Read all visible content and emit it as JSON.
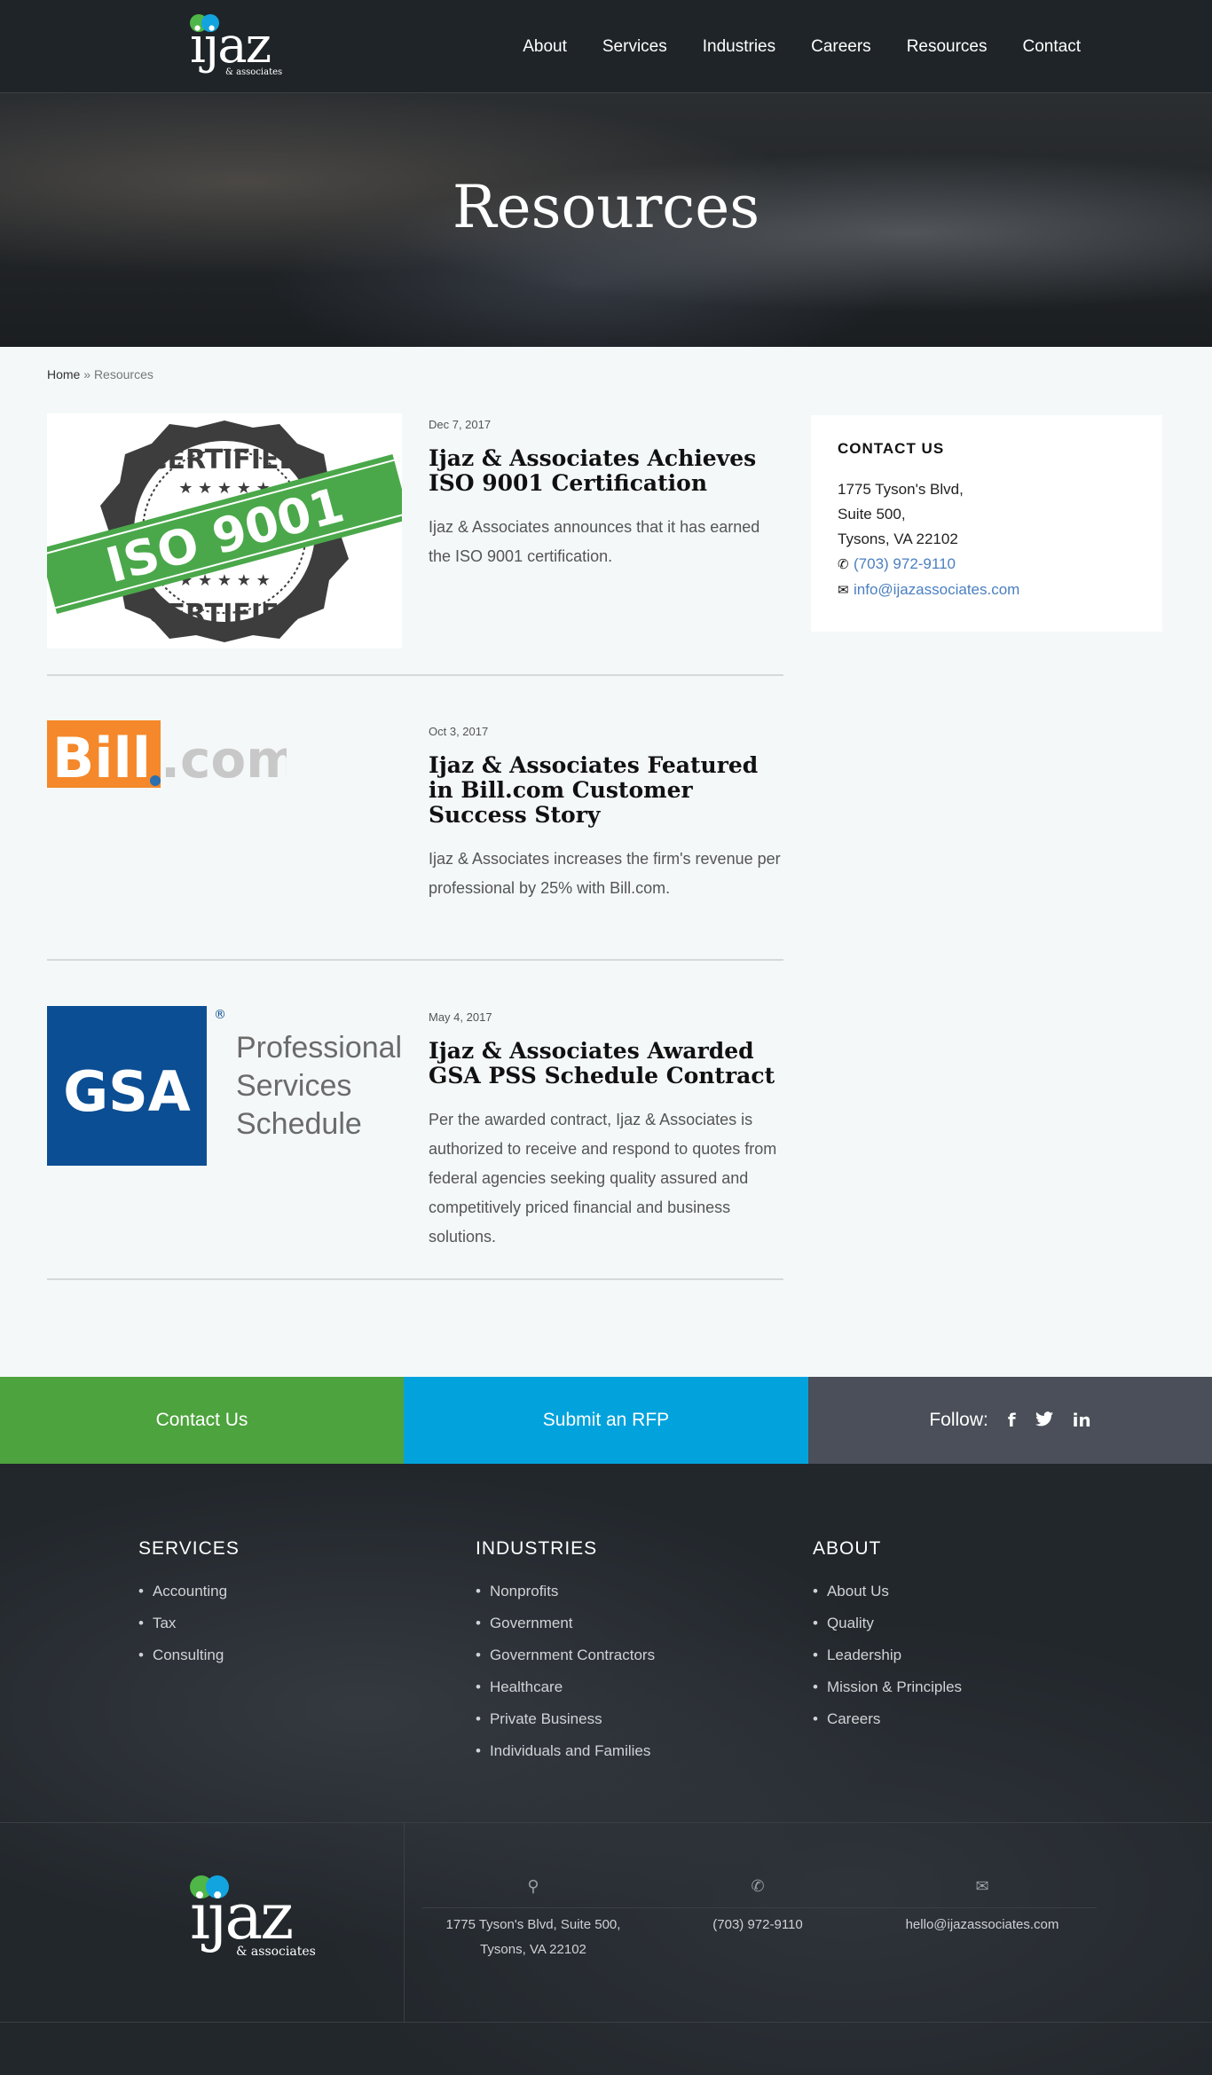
{
  "header": {
    "logo_word": "ijaz",
    "logo_sub": "& associates",
    "nav": [
      "About",
      "Services",
      "Industries",
      "Careers",
      "Resources",
      "Contact"
    ]
  },
  "hero": {
    "title": "Resources"
  },
  "breadcrumb": {
    "home": "Home",
    "separator": "»",
    "current": "Resources"
  },
  "posts": [
    {
      "date": "Dec 7, 2017",
      "title": "Ijaz & Associates Achieves ISO 9001 Certification",
      "excerpt": "Ijaz & Associates announces that it has earned the ISO 9001 certification.",
      "image": {
        "top_text": "CERTIFIED",
        "main_text": "ISO 9001",
        "bottom_text": "CERTIFIED"
      }
    },
    {
      "date": "Oct 3, 2017",
      "title": "Ijaz & Associates Featured in Bill.com Customer Success Story",
      "excerpt": "Ijaz & Associates increases the firm's revenue per professional by 25% with Bill.com.",
      "image": {
        "part1": "Bill",
        "part2": ".com"
      }
    },
    {
      "date": "May 4, 2017",
      "title": "Ijaz & Associates Awarded GSA PSS Schedule Contract",
      "excerpt": "Per the awarded contract, Ijaz & Associates is authorized to receive and respond to quotes from federal agencies seeking quality assured and competitively priced financial and business solutions.",
      "image": {
        "mark": "GSA",
        "registered": "®",
        "line1": "Professional",
        "line2": "Services",
        "line3": "Schedule"
      }
    }
  ],
  "sidebar": {
    "heading": "CONTACT US",
    "address1": "1775 Tyson's Blvd,",
    "address2": "Suite 500,",
    "address3": "Tysons, VA 22102",
    "phone": "(703) 972-9110",
    "email": "info@ijazassociates.com"
  },
  "cta": {
    "contact": "Contact Us",
    "rfp": "Submit an RFP",
    "follow": "Follow:",
    "social": [
      "facebook-icon",
      "twitter-icon",
      "linkedin-icon"
    ]
  },
  "footer": {
    "services": {
      "heading": "SERVICES",
      "items": [
        "Accounting",
        "Tax",
        "Consulting"
      ]
    },
    "industries": {
      "heading": "INDUSTRIES",
      "items": [
        "Nonprofits",
        "Government",
        "Government Contractors",
        "Healthcare",
        "Private Business",
        "Individuals and Families"
      ]
    },
    "about": {
      "heading": "ABOUT",
      "items": [
        "About Us",
        "Quality",
        "Leadership",
        "Mission & Principles",
        "Careers"
      ]
    },
    "address_line1": "1775 Tyson's Blvd, Suite 500,",
    "address_line2": "Tysons, VA 22102",
    "phone": "(703) 972-9110",
    "email": "hello@ijazassociates.com"
  },
  "colors": {
    "green": "#4da33d",
    "blue": "#02a3dd",
    "slate": "#4a4f59",
    "dark": "#1f2428",
    "link": "#4a7fc0"
  }
}
